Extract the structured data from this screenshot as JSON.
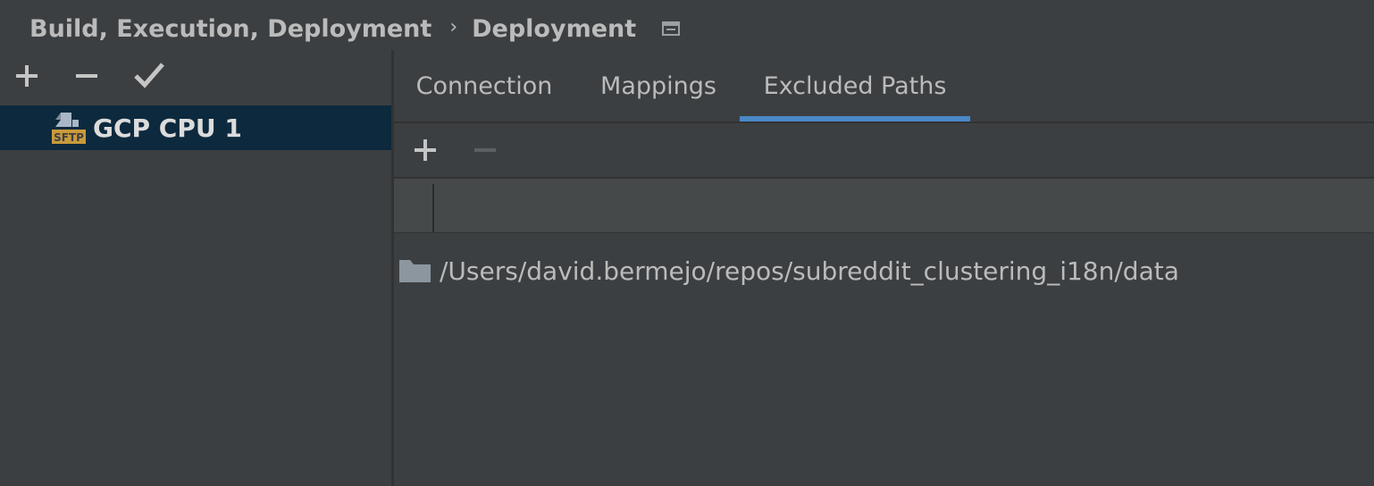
{
  "breadcrumb": {
    "parent": "Build, Execution, Deployment",
    "separator": "›",
    "current": "Deployment",
    "icon": "window-icon"
  },
  "left_toolbar": {
    "add_icon": "plus-icon",
    "remove_icon": "minus-icon",
    "default_icon": "checkmark-icon"
  },
  "servers": [
    {
      "label": "GCP CPU 1",
      "type_badge": "SFTP",
      "selected": true
    }
  ],
  "tabs": [
    {
      "label": "Connection",
      "selected": false
    },
    {
      "label": "Mappings",
      "selected": false
    },
    {
      "label": "Excluded Paths",
      "selected": true
    }
  ],
  "excluded_paths": {
    "toolbar": {
      "add_icon": "plus-icon",
      "remove_icon": "minus-icon",
      "remove_enabled": false
    },
    "rows": [
      {
        "icon": "folder-icon",
        "path": "/Users/david.bermejo/repos/subreddit_clustering_i18n/data"
      }
    ]
  },
  "colors": {
    "background": "#3c3f41",
    "selection": "#0d293e",
    "accent": "#4a88c7",
    "text": "#bbbbbb",
    "sftp_badge": "#c99a3b"
  }
}
